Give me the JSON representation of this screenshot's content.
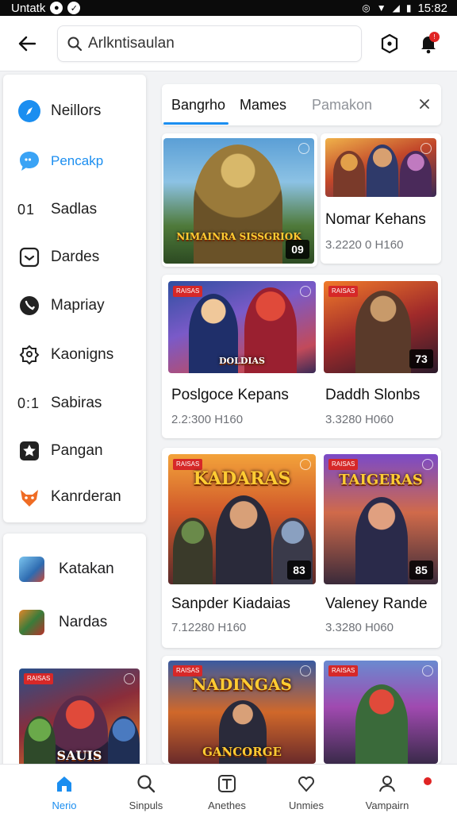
{
  "status_bar": {
    "left_text": "Untatk",
    "time": "15:82"
  },
  "search": {
    "value": "Arlkntisaulan"
  },
  "sidebar": {
    "items": [
      {
        "label": "Neillors",
        "icon": "compass-icon"
      },
      {
        "label": "Pencakp",
        "icon": "chat-bubble-icon",
        "active": true
      },
      {
        "prefix": "01",
        "label": "Sadlas"
      },
      {
        "label": "Dardes",
        "icon": "inbox-icon"
      },
      {
        "label": "Mapriay",
        "icon": "phone-icon"
      },
      {
        "label": "Kaonigns",
        "icon": "badge-icon"
      },
      {
        "prefix": "0:1",
        "label": "Sabiras"
      },
      {
        "label": "Pangan",
        "icon": "star-shield-icon"
      },
      {
        "label": "Kanrderan",
        "icon": "fox-icon"
      }
    ],
    "games": [
      {
        "label": "Katakan"
      },
      {
        "label": "Nardas"
      }
    ],
    "promo": {
      "tag": "RAISAS",
      "logo": "SAUIS"
    }
  },
  "tabs": [
    {
      "label": "Bangrho",
      "active": true
    },
    {
      "label": "Mames"
    },
    {
      "label": "Pamakon"
    }
  ],
  "cards": [
    {
      "title": "",
      "meta": "",
      "badge": "09",
      "logo": "NIMAINRA SISSGRIOK",
      "tag": ""
    },
    {
      "title": "Nomar Kehans",
      "meta": "3.2220 0 H160",
      "badge": "",
      "logo": "",
      "tag": ""
    },
    {
      "title": "Poslgoce Kepans",
      "meta": "2.2:300 H160",
      "badge": "",
      "logo": "DOLDIAS",
      "tag": "RAISAS"
    },
    {
      "title": "Daddh Slonbs",
      "meta": "3.3280 H060",
      "badge": "73",
      "logo": "",
      "tag": "RAISAS"
    },
    {
      "title": "Sanpder Kiadaias",
      "meta": "7.12280 H160",
      "badge": "83",
      "logo": "KADARAS",
      "tag": "RAISAS"
    },
    {
      "title": "Valeney Rande",
      "meta": "3.3280 H060",
      "badge": "85",
      "logo": "TAIGERAS",
      "tag": "RAISAS"
    },
    {
      "title": "",
      "meta": "",
      "badge": "",
      "logo": "NADINGAS",
      "tag": "RAISAS",
      "sub_logo": "GANCORGE"
    },
    {
      "title": "",
      "meta": "",
      "badge": "",
      "logo": "",
      "tag": "RAISAS"
    }
  ],
  "bottom_nav": [
    {
      "label": "Nerio",
      "icon": "home-icon",
      "active": true
    },
    {
      "label": "Sinpuls",
      "icon": "search-icon"
    },
    {
      "label": "Anethes",
      "icon": "text-box-icon"
    },
    {
      "label": "Unmies",
      "icon": "heart-icon"
    },
    {
      "label": "Vampairn",
      "icon": "profile-icon"
    }
  ],
  "colors": {
    "accent": "#1b8ef0",
    "badge_red": "#e02424"
  }
}
